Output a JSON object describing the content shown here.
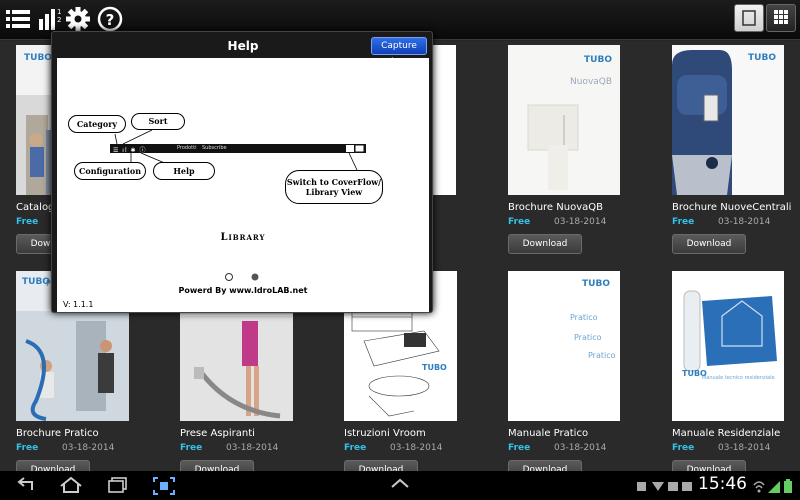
{
  "topbar": {
    "icons": [
      "category-icon",
      "sort-icon",
      "settings-icon",
      "help-icon"
    ],
    "view_buttons": [
      "coverflow-view-icon",
      "grid-view-icon"
    ]
  },
  "help_dialog": {
    "title": "Help",
    "capture_button": "Capture Log",
    "callouts": {
      "category": "Category",
      "sort": "Sort",
      "configuration": "Configuration",
      "help": "Help",
      "switch": "Switch to CoverFlow/ Library View"
    },
    "toolbar_tabs": [
      "Prodotti",
      "Subscribe"
    ],
    "library_label": "Library",
    "powered_by": "Powerd By www.IdroLAB.net",
    "version": "V: 1.1.1",
    "page_dots": 2,
    "active_page": 2
  },
  "catalog": {
    "price_color": "#35c0e8",
    "download_label": "Download",
    "items": [
      {
        "title": "Catalogo",
        "price": "Free",
        "date": "",
        "cover": "people"
      },
      {
        "title": "",
        "price": "",
        "date": "",
        "cover": "blank"
      },
      {
        "title": "",
        "price": "",
        "date": "",
        "cover": "blank"
      },
      {
        "title": "Brochure NuovaQB",
        "price": "Free",
        "date": "03-18-2014",
        "cover": "nuovaqb"
      },
      {
        "title": "Brochure NuoveCentrali",
        "price": "Free",
        "date": "03-18-2014",
        "cover": "centrali"
      },
      {
        "title": "Brochure Pratico",
        "price": "Free",
        "date": "03-18-2014",
        "cover": "pratico"
      },
      {
        "title": "Prese Aspiranti",
        "price": "Free",
        "date": "03-18-2014",
        "cover": "prese"
      },
      {
        "title": "Istruzioni Vroom",
        "price": "Free",
        "date": "03-18-2014",
        "cover": "vroom"
      },
      {
        "title": "Manuale Pratico",
        "price": "Free",
        "date": "03-18-2014",
        "cover": "manuale_pratico"
      },
      {
        "title": "Manuale Residenziale",
        "price": "Free",
        "date": "03-18-2014",
        "cover": "residenziale"
      }
    ]
  },
  "cover_text": {
    "brand": "TUBO",
    "nuovaqb": "NuovaQB",
    "pratico": "Pratico",
    "residenziale": "Manuale tecnico residenziale"
  },
  "statusbar": {
    "time": "15:46"
  }
}
